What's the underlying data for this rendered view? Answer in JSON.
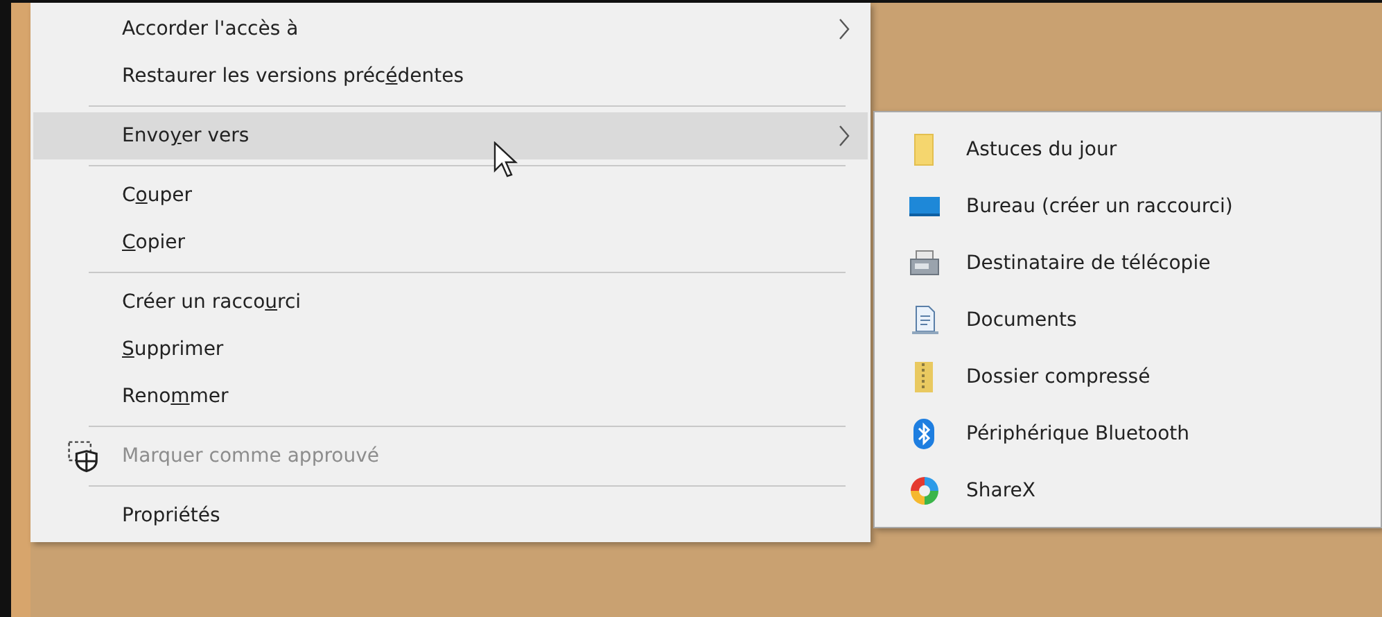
{
  "context_menu": {
    "items": [
      {
        "kind": "item",
        "parts": [
          {
            "text": "Accorder l'accès à",
            "underlined": false
          }
        ],
        "submenu": true,
        "selected": false,
        "disabled": false
      },
      {
        "kind": "item",
        "parts": [
          {
            "text": "Restaurer les versions préc",
            "underlined": false
          },
          {
            "text": "é",
            "underlined": true
          },
          {
            "text": "dentes",
            "underlined": false
          }
        ],
        "submenu": false,
        "selected": false,
        "disabled": false
      },
      {
        "kind": "separator"
      },
      {
        "kind": "item",
        "parts": [
          {
            "text": "Envo",
            "underlined": false
          },
          {
            "text": "y",
            "underlined": true
          },
          {
            "text": "er vers",
            "underlined": false
          }
        ],
        "submenu": true,
        "selected": true,
        "disabled": false
      },
      {
        "kind": "separator"
      },
      {
        "kind": "item",
        "parts": [
          {
            "text": "C",
            "underlined": false
          },
          {
            "text": "o",
            "underlined": true
          },
          {
            "text": "uper",
            "underlined": false
          }
        ],
        "submenu": false,
        "selected": false,
        "disabled": false
      },
      {
        "kind": "item",
        "parts": [
          {
            "text": "C",
            "underlined": true
          },
          {
            "text": "opier",
            "underlined": false
          }
        ],
        "submenu": false,
        "selected": false,
        "disabled": false
      },
      {
        "kind": "separator"
      },
      {
        "kind": "item",
        "parts": [
          {
            "text": "Créer un racco",
            "underlined": false
          },
          {
            "text": "u",
            "underlined": true
          },
          {
            "text": "rci",
            "underlined": false
          }
        ],
        "submenu": false,
        "selected": false,
        "disabled": false
      },
      {
        "kind": "item",
        "parts": [
          {
            "text": "S",
            "underlined": true
          },
          {
            "text": "upprimer",
            "underlined": false
          }
        ],
        "submenu": false,
        "selected": false,
        "disabled": false
      },
      {
        "kind": "item",
        "parts": [
          {
            "text": "Reno",
            "underlined": false
          },
          {
            "text": "m",
            "underlined": true
          },
          {
            "text": "mer",
            "underlined": false
          }
        ],
        "submenu": false,
        "selected": false,
        "disabled": false
      },
      {
        "kind": "separator"
      },
      {
        "kind": "item",
        "parts": [
          {
            "text": "Marquer comme approuvé",
            "underlined": false
          }
        ],
        "submenu": false,
        "selected": false,
        "disabled": true,
        "shield": true
      },
      {
        "kind": "separator"
      },
      {
        "kind": "item",
        "parts": [
          {
            "text": "Propriétés",
            "underlined": false
          }
        ],
        "submenu": false,
        "selected": false,
        "disabled": false
      }
    ]
  },
  "submenu": {
    "items": [
      {
        "kind": "folder",
        "label": "Astuces du jour"
      },
      {
        "kind": "desktop",
        "label": "Bureau (créer un raccourci)"
      },
      {
        "kind": "fax",
        "label": "Destinataire de télécopie"
      },
      {
        "kind": "document",
        "label": "Documents"
      },
      {
        "kind": "zip",
        "label": "Dossier compressé"
      },
      {
        "kind": "bluetooth",
        "label": "Périphérique Bluetooth"
      },
      {
        "kind": "app",
        "label": "ShareX"
      }
    ]
  }
}
